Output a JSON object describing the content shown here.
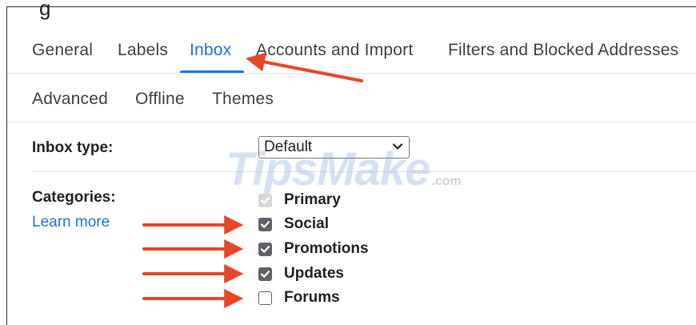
{
  "tabs": [
    {
      "label": "General",
      "active": false
    },
    {
      "label": "Labels",
      "active": false
    },
    {
      "label": "Inbox",
      "active": true
    },
    {
      "label": "Accounts and Import",
      "active": false
    },
    {
      "label": "Filters and Blocked Addresses",
      "active": false
    },
    {
      "label": "Advanced",
      "active": false
    },
    {
      "label": "Offline",
      "active": false
    },
    {
      "label": "Themes",
      "active": false
    }
  ],
  "inbox_type": {
    "label": "Inbox type:",
    "selected": "Default"
  },
  "categories": {
    "label": "Categories:",
    "learn_more": "Learn more",
    "items": [
      {
        "label": "Primary",
        "checked": true,
        "disabled": true
      },
      {
        "label": "Social",
        "checked": true,
        "disabled": false
      },
      {
        "label": "Promotions",
        "checked": true,
        "disabled": false
      },
      {
        "label": "Updates",
        "checked": true,
        "disabled": false
      },
      {
        "label": "Forums",
        "checked": false,
        "disabled": false
      }
    ]
  },
  "watermark": {
    "main": "TipsMake",
    "suffix": ".com"
  },
  "colors": {
    "accent": "#1a73e8",
    "annotation_arrow": "#e8462a",
    "checkbox_checked": "#5f6368",
    "checkbox_disabled": "#d7d7d7"
  }
}
